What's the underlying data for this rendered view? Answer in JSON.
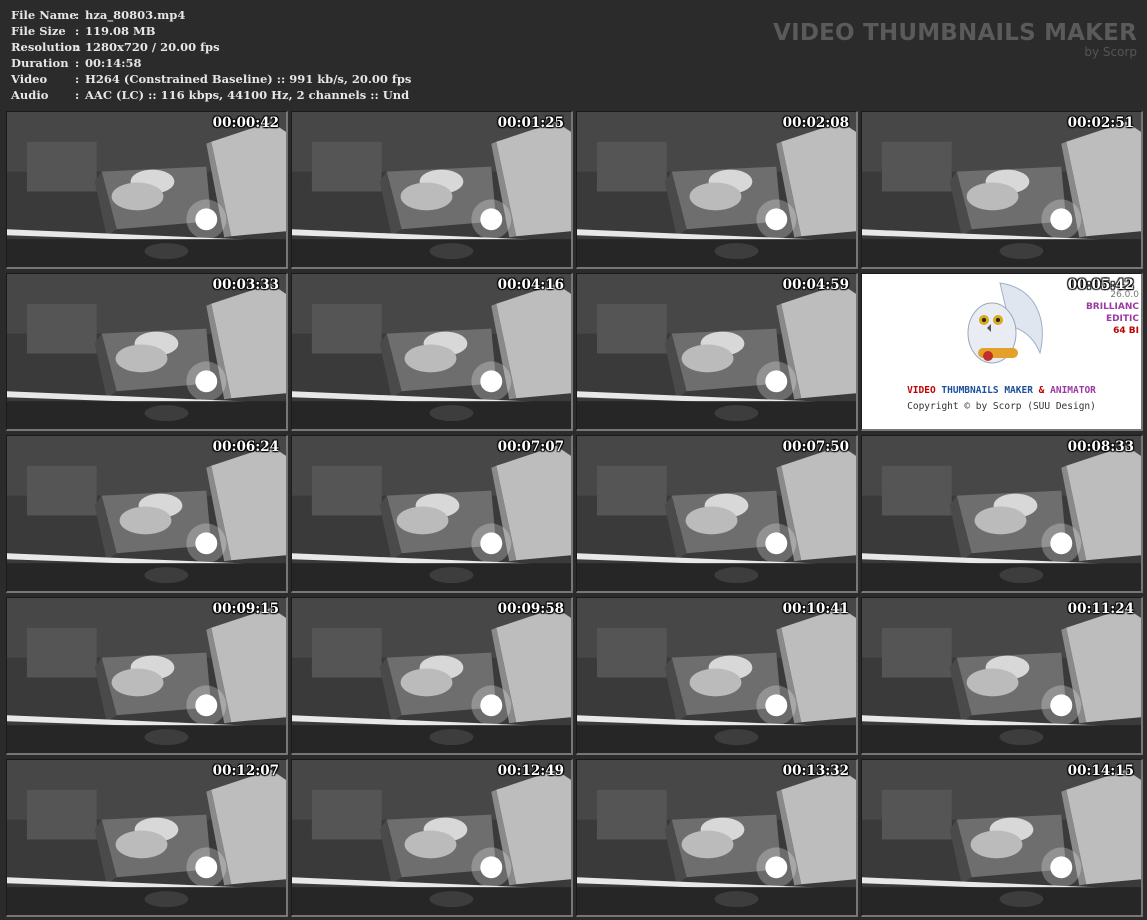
{
  "file_info": [
    {
      "key": "File Name",
      "sep": ":",
      "value": "hza_80803.mp4"
    },
    {
      "key": "File Size",
      "sep": ":",
      "value": "119.08 MB"
    },
    {
      "key": "Resolution",
      "sep": ":",
      "value": "1280x720 / 20.00 fps"
    },
    {
      "key": "Duration",
      "sep": ":",
      "value": "00:14:58"
    },
    {
      "key": "Video",
      "sep": ":",
      "value": "H264 (Constrained Baseline) :: 991 kb/s, 20.00 fps"
    },
    {
      "key": "Audio",
      "sep": ":",
      "value": "AAC (LC) :: 116 kbps, 44100 Hz, 2 channels :: Und"
    }
  ],
  "brand": {
    "title": "VIDEO THUMBNAILS MAKER",
    "subtitle": "by Scorp"
  },
  "thumbnails": [
    {
      "timestamp": "00:00:42"
    },
    {
      "timestamp": "00:01:25"
    },
    {
      "timestamp": "00:02:08"
    },
    {
      "timestamp": "00:02:51"
    },
    {
      "timestamp": "00:03:33"
    },
    {
      "timestamp": "00:04:16"
    },
    {
      "timestamp": "00:04:59"
    },
    {
      "timestamp": "00:05:42",
      "logo": true
    },
    {
      "timestamp": "00:06:24"
    },
    {
      "timestamp": "00:07:07"
    },
    {
      "timestamp": "00:07:50"
    },
    {
      "timestamp": "00:08:33"
    },
    {
      "timestamp": "00:09:15"
    },
    {
      "timestamp": "00:09:58"
    },
    {
      "timestamp": "00:10:41"
    },
    {
      "timestamp": "00:11:24"
    },
    {
      "timestamp": "00:12:07"
    },
    {
      "timestamp": "00:12:49"
    },
    {
      "timestamp": "00:13:32"
    },
    {
      "timestamp": "00:14:15"
    }
  ],
  "logo_card": {
    "version_lines": [
      "26.0.0",
      "BRILLIANC",
      "EDITIC",
      "64 BI"
    ],
    "main_words": [
      "VIDEO",
      "THUMBNAILS MAKER",
      "&",
      "ANIMATOR"
    ],
    "copyright": "Copyright © by Scorp (SUU Design)"
  },
  "colors": {
    "background": "#2b2b2b",
    "info_text": "#e6e6e6",
    "brand_text": "#5a5a5a",
    "logo_red": "#c00000",
    "logo_blue": "#1c4f9c",
    "logo_purple": "#9b3aa3"
  }
}
